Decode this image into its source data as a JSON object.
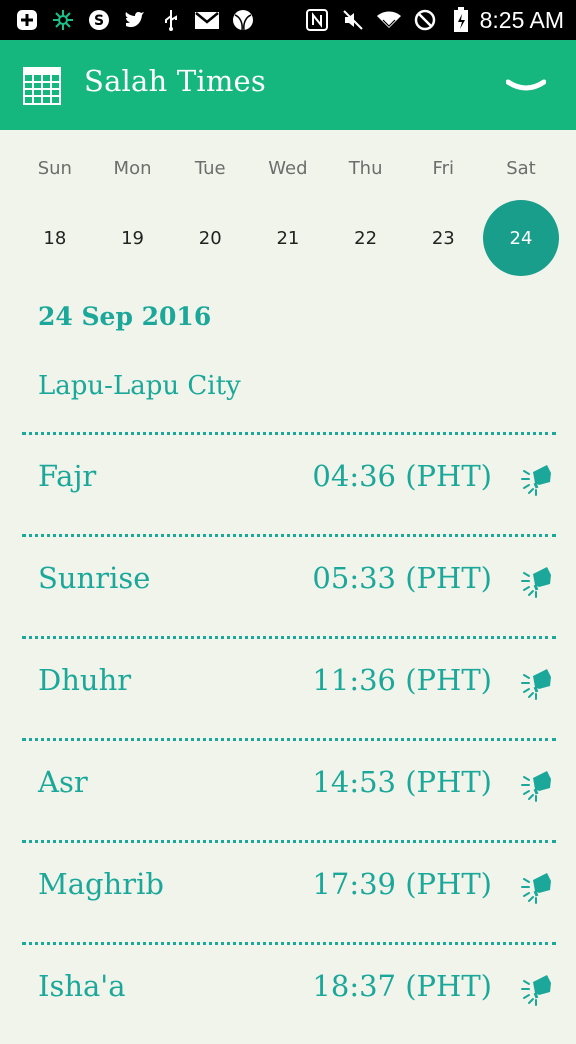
{
  "status_bar": {
    "time": "8:25 AM",
    "icons": [
      "add-icon",
      "app-icon",
      "skype-icon",
      "twitter-icon",
      "usb-icon",
      "gmail-icon",
      "ball-icon",
      "nfc-icon",
      "mute-icon",
      "wifi-icon",
      "blocked-icon",
      "battery-icon"
    ]
  },
  "appbar": {
    "title": "Salah Times",
    "icon": "calendar-grid-icon",
    "toggle_icon": "chevron-down-icon",
    "color": "#16b67f"
  },
  "week": {
    "days": [
      "Sun",
      "Mon",
      "Tue",
      "Wed",
      "Thu",
      "Fri",
      "Sat"
    ],
    "dates": [
      "18",
      "19",
      "20",
      "21",
      "22",
      "23",
      "24"
    ],
    "selected_index": 6,
    "selected_color": "#1a9e8c"
  },
  "full_date": "24 Sep 2016",
  "city": "Lapu-Lapu City",
  "accent": "#1ba89a",
  "prayers": [
    {
      "name": "Fajr",
      "time": "04:36 (PHT)",
      "icon": "alarm-megaphone-icon"
    },
    {
      "name": "Sunrise",
      "time": "05:33 (PHT)",
      "icon": "alarm-megaphone-icon"
    },
    {
      "name": "Dhuhr",
      "time": "11:36 (PHT)",
      "icon": "alarm-megaphone-icon"
    },
    {
      "name": "Asr",
      "time": "14:53 (PHT)",
      "icon": "alarm-megaphone-icon"
    },
    {
      "name": "Maghrib",
      "time": "17:39 (PHT)",
      "icon": "alarm-megaphone-icon"
    },
    {
      "name": "Isha'a",
      "time": "18:37 (PHT)",
      "icon": "alarm-megaphone-icon"
    }
  ]
}
